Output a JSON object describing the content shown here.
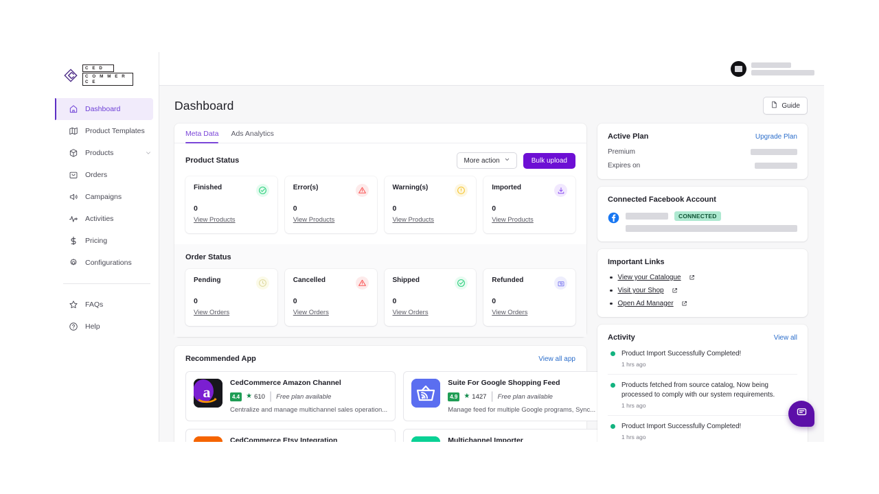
{
  "brand": {
    "line1": "C E D",
    "line2": "C O M M E R C E"
  },
  "sidebar": {
    "items": [
      {
        "label": "Dashboard",
        "icon": "home-icon",
        "active": true
      },
      {
        "label": "Product Templates",
        "icon": "map-icon",
        "active": false
      },
      {
        "label": "Products",
        "icon": "box-icon",
        "active": false,
        "expandable": true
      },
      {
        "label": "Orders",
        "icon": "bag-icon",
        "active": false
      },
      {
        "label": "Campaigns",
        "icon": "megaphone-icon",
        "active": false
      },
      {
        "label": "Activities",
        "icon": "pulse-icon",
        "active": false
      },
      {
        "label": "Pricing",
        "icon": "dollar-icon",
        "active": false
      },
      {
        "label": "Configurations",
        "icon": "gear-icon",
        "active": false
      }
    ],
    "footer_items": [
      {
        "label": "FAQs",
        "icon": "star-icon"
      },
      {
        "label": "Help",
        "icon": "question-circle-icon"
      }
    ]
  },
  "header": {
    "title": "Dashboard",
    "guide_label": "Guide",
    "guide_icon": "document-icon"
  },
  "tabs": [
    {
      "label": "Meta Data",
      "active": true
    },
    {
      "label": "Ads Analytics",
      "active": false
    }
  ],
  "product_status": {
    "title": "Product Status",
    "more_action_label": "More action",
    "bulk_upload_label": "Bulk upload",
    "cards": [
      {
        "label": "Finished",
        "value": "0",
        "link": "View Products",
        "icon": "check-circle-icon",
        "color": "#2bd07c",
        "bg": "#e4fbef"
      },
      {
        "label": "Error(s)",
        "value": "0",
        "link": "View Products",
        "icon": "alert-triangle-icon",
        "color": "#fa5252",
        "bg": "#fdeaea"
      },
      {
        "label": "Warning(s)",
        "value": "0",
        "link": "View Products",
        "icon": "alert-circle-icon",
        "color": "#f5c429",
        "bg": "#fdf6e0"
      },
      {
        "label": "Imported",
        "value": "0",
        "link": "View Products",
        "icon": "download-icon",
        "color": "#8b4ff0",
        "bg": "#f1e8fe"
      }
    ]
  },
  "order_status": {
    "title": "Order Status",
    "cards": [
      {
        "label": "Pending",
        "value": "0",
        "link": "View Orders",
        "icon": "clock-icon",
        "color": "#d8d38a",
        "bg": "#fbfae8"
      },
      {
        "label": "Cancelled",
        "value": "0",
        "link": "View Orders",
        "icon": "alert-triangle-icon",
        "color": "#fa5252",
        "bg": "#fdeaea"
      },
      {
        "label": "Shipped",
        "value": "0",
        "link": "View Orders",
        "icon": "check-circle-icon",
        "color": "#2bd07c",
        "bg": "#e9fbf2"
      },
      {
        "label": "Refunded",
        "value": "0",
        "link": "View Orders",
        "icon": "refund-box-icon",
        "color": "#7b78f0",
        "bg": "#eeeefd"
      }
    ]
  },
  "recommended": {
    "title": "Recommended App",
    "view_all_label": "View all app",
    "apps": [
      {
        "name": "CedCommerce Amazon Channel",
        "rating": "4.4",
        "reviews": "610",
        "plan": "Free plan available",
        "desc": "Centralize and manage multichannel sales operation...",
        "icon": "amazon-icon"
      },
      {
        "name": "Suite For Google Shopping Feed",
        "rating": "4.9",
        "reviews": "1427",
        "plan": "Free plan available",
        "desc": "Manage feed for multiple Google programs, Sync...",
        "icon": "google-shopping-icon"
      },
      {
        "name": "CedCommerce Etsy Integration",
        "icon": "etsy-icon"
      },
      {
        "name": "Multichannel Importer",
        "icon": "importer-icon"
      }
    ]
  },
  "active_plan": {
    "title": "Active Plan",
    "upgrade_label": "Upgrade Plan",
    "rows": [
      {
        "key": "Premium"
      },
      {
        "key": "Expires on"
      }
    ]
  },
  "facebook": {
    "title": "Connected Facebook Account",
    "status_label": "CONNECTED",
    "icon": "facebook-icon"
  },
  "important_links": {
    "title": "Important Links",
    "links": [
      {
        "label": "View your Catalogue",
        "icon": "external-link-icon"
      },
      {
        "label": "Visit your Shop",
        "icon": "external-link-icon"
      },
      {
        "label": "Open Ad Manager",
        "icon": "external-link-icon"
      }
    ]
  },
  "activity": {
    "title": "Activity",
    "view_all_label": "View all",
    "items": [
      {
        "text": "Product Import Successfully Completed!",
        "time": "1 hrs ago"
      },
      {
        "text": "Products fetched from source catalog, Now being processed to comply with our system requirements.",
        "time": "1 hrs ago"
      },
      {
        "text": "Product Import Successfully Completed!",
        "time": "1 hrs ago"
      }
    ]
  },
  "chat": {
    "icon": "chat-bubble-icon"
  },
  "colors": {
    "brand_purple": "#6d0fd4",
    "accent_purple": "#7a45d8",
    "link_blue": "#2c6ecb",
    "success_green": "#13b37f",
    "page_bg": "#f7f7f8"
  }
}
